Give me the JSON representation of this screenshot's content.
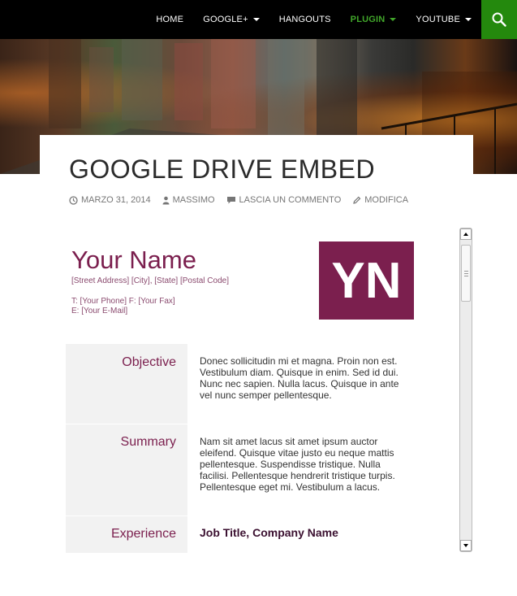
{
  "nav": {
    "items": [
      {
        "label": "HOME",
        "dropdown": false,
        "active": false
      },
      {
        "label": "GOOGLE+",
        "dropdown": true,
        "active": false
      },
      {
        "label": "HANGOUTS",
        "dropdown": false,
        "active": false
      },
      {
        "label": "PLUGIN",
        "dropdown": true,
        "active": true
      },
      {
        "label": "YOUTUBE",
        "dropdown": true,
        "active": false
      }
    ],
    "search_icon": "search-icon",
    "accent_color": "#41a62a",
    "search_bg": "#24890d"
  },
  "post": {
    "title": "GOOGLE DRIVE EMBED",
    "meta": {
      "date": "MARZO 31, 2014",
      "author": "MASSIMO",
      "comments": "LASCIA UN COMMENTO",
      "edit": "MODIFICA"
    }
  },
  "resume": {
    "name": "Your Name",
    "address": "[Street Address] [City], [State] [Postal Code]",
    "phone_fax": "T: [Your Phone]  F: [Your Fax]",
    "email": "E: [Your E-Mail]",
    "initials": "YN",
    "accent_color": "#7b1f4e",
    "sections": [
      {
        "label": "Objective",
        "text": "Donec sollicitudin mi et magna. Proin non est. Vestibulum diam. Quisque in enim. Sed id dui. Nunc nec sapien. Nulla lacus. Quisque in ante vel nunc semper pellentesque."
      },
      {
        "label": "Summary",
        "text": "Nam sit amet lacus sit amet ipsum auctor eleifend. Quisque vitae justo eu neque mattis pellentesque. Suspendisse tristique. Nulla facilisi. Pellentesque hendrerit tristique turpis. Pellentesque eget mi. Vestibulum a lacus."
      },
      {
        "label": "Experience",
        "text": "Job Title, Company Name"
      }
    ]
  }
}
